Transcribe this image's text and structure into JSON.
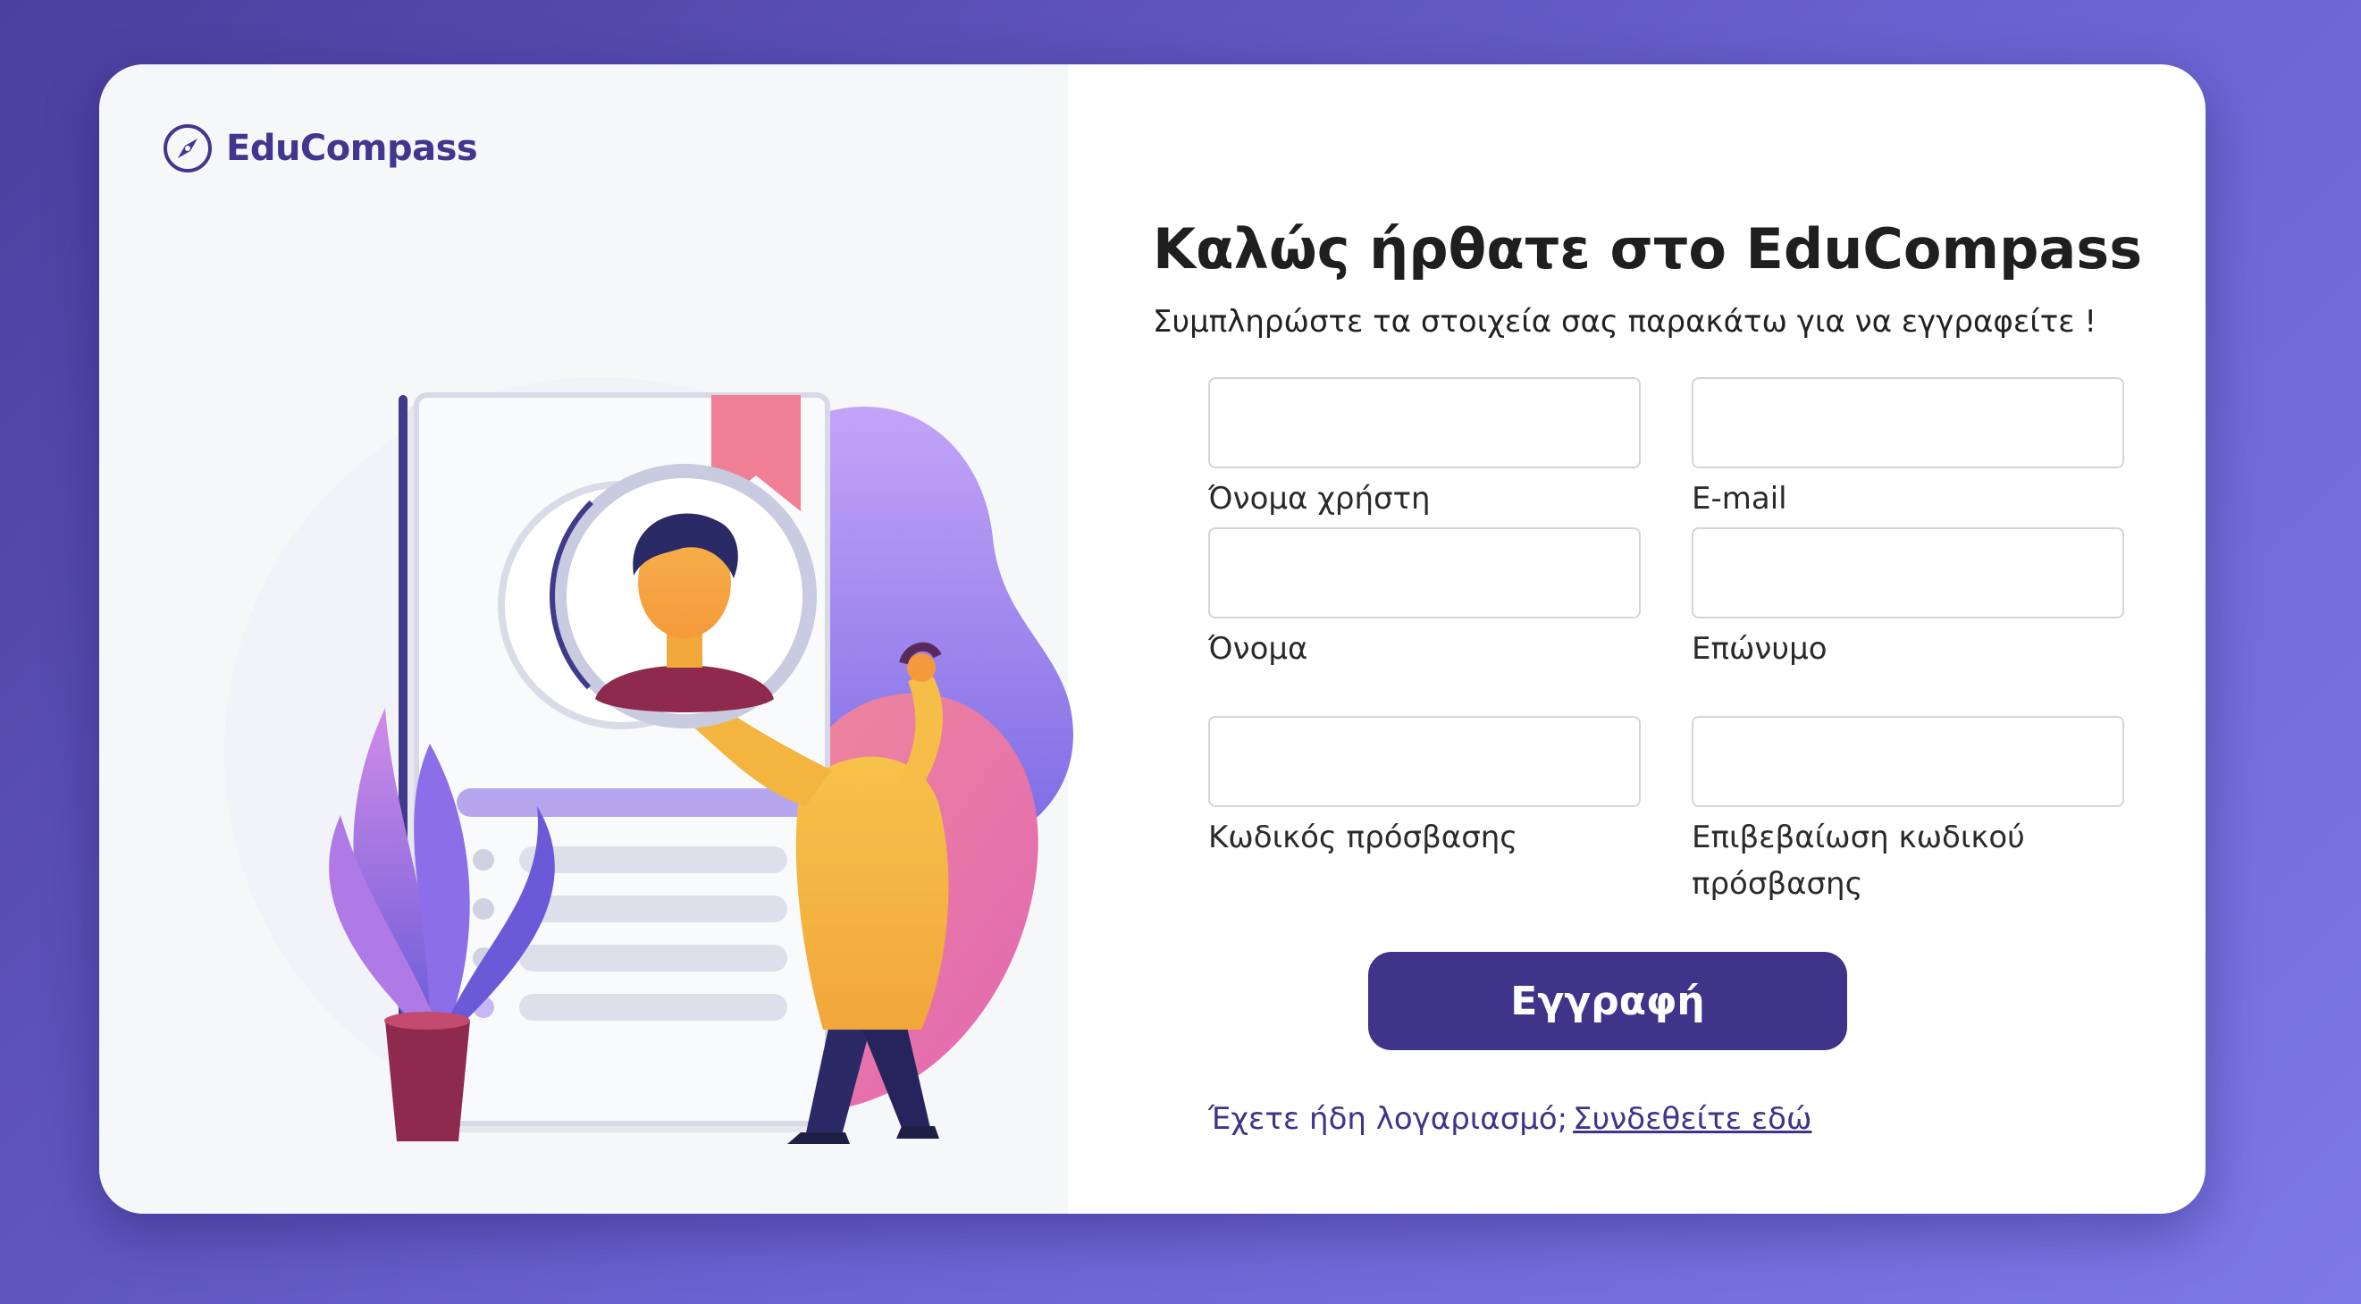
{
  "app": {
    "brand": "EduCompass"
  },
  "colors": {
    "accent": "#40338a",
    "brand": "#43368e",
    "background_start": "#4a3f9e",
    "background_end": "#7c78e6"
  },
  "heading": {
    "title": "Καλώς ήρθατε στο EduCompass",
    "subtitle": "Συμπληρώστε τα στοιχεία σας παρακάτω για να εγγραφείτε !"
  },
  "form": {
    "username": {
      "label": "Όνομα χρήστη",
      "value": ""
    },
    "email": {
      "label": "E-mail",
      "value": ""
    },
    "first_name": {
      "label": "Όνομα",
      "value": ""
    },
    "last_name": {
      "label": "Επώνυμο",
      "value": ""
    },
    "password": {
      "label": "Κωδικός πρόσβασης",
      "value": ""
    },
    "password_confirm": {
      "label": "Επιβεβαίωση κωδικού πρόσβασης",
      "value": ""
    },
    "submit_label": "Εγγραφή"
  },
  "footer": {
    "prompt": "Έχετε ήδη λογαριασμό;",
    "link_label": "Συνδεθείτε εδώ"
  },
  "icons": {
    "logo": "compass-icon",
    "illustration": "user-profile-illustration"
  }
}
